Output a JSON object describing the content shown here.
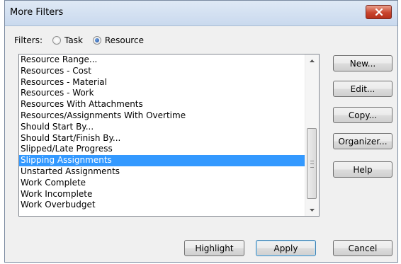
{
  "window": {
    "title": "More Filters"
  },
  "filters": {
    "label": "Filters:",
    "options": [
      {
        "label": "Task",
        "checked": false
      },
      {
        "label": "Resource",
        "checked": true
      }
    ]
  },
  "list": {
    "items": [
      "Resource Range...",
      "Resources - Cost",
      "Resources - Material",
      "Resources - Work",
      "Resources With Attachments",
      "Resources/Assignments With Overtime",
      "Should Start By...",
      "Should Start/Finish By...",
      "Slipped/Late Progress",
      "Slipping Assignments",
      "Unstarted Assignments",
      "Work Complete",
      "Work Incomplete",
      "Work Overbudget"
    ],
    "selected_index": 9
  },
  "side_buttons": {
    "new_label": "New...",
    "edit_label": "Edit...",
    "copy_label": "Copy...",
    "organizer_label": "Organizer...",
    "help_label": "Help"
  },
  "bottom_buttons": {
    "highlight_label": "Highlight",
    "apply_label": "Apply",
    "cancel_label": "Cancel"
  },
  "colors": {
    "selection": "#3399ff",
    "close_button": "#c9452d"
  },
  "icons": {
    "close": "close-icon",
    "scroll_up": "scroll-up-arrow-icon",
    "scroll_down": "scroll-down-arrow-icon",
    "grip": "scrollbar-grip-icon"
  }
}
